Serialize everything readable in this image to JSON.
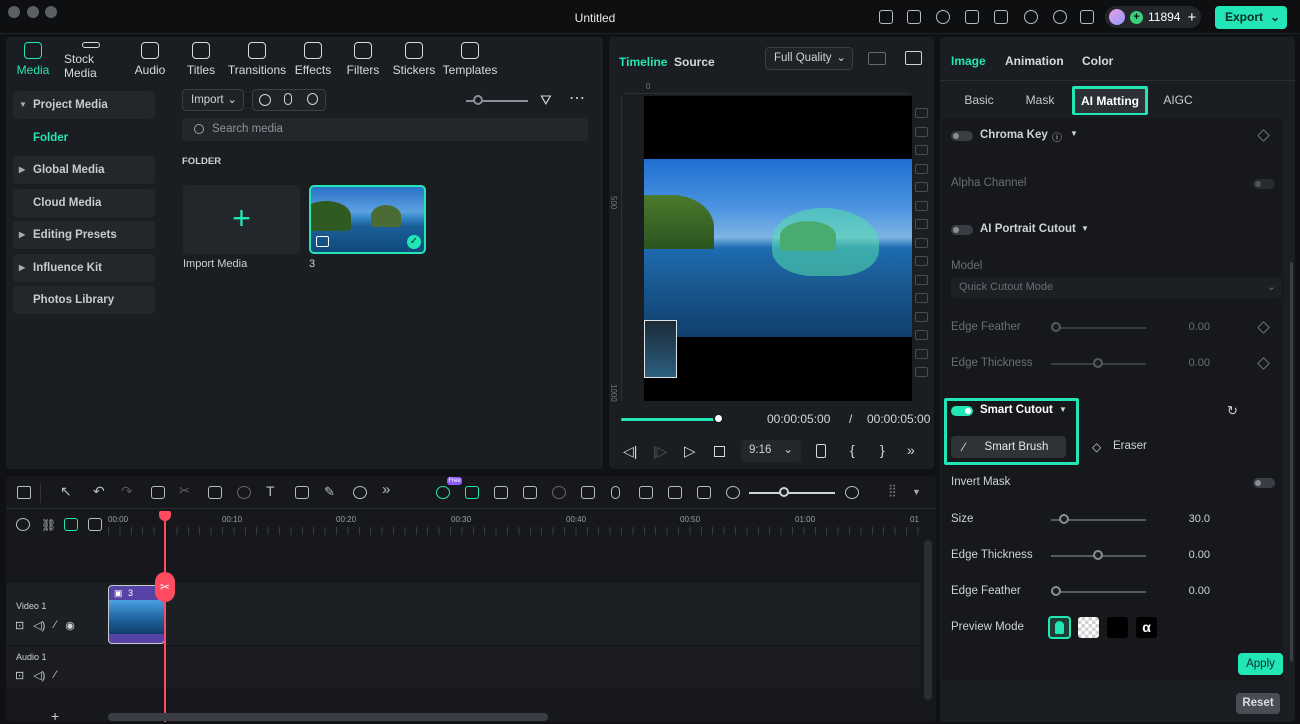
{
  "window": {
    "title": "Untitled",
    "credits": "11894",
    "export_label": "Export"
  },
  "topnav": [
    {
      "label": "Media",
      "icon": "media-icon",
      "active": true
    },
    {
      "label": "Stock Media",
      "icon": "stock-media-icon"
    },
    {
      "label": "Audio",
      "icon": "audio-icon"
    },
    {
      "label": "Titles",
      "icon": "titles-icon"
    },
    {
      "label": "Transitions",
      "icon": "transitions-icon"
    },
    {
      "label": "Effects",
      "icon": "effects-icon"
    },
    {
      "label": "Filters",
      "icon": "filters-icon"
    },
    {
      "label": "Stickers",
      "icon": "stickers-icon"
    },
    {
      "label": "Templates",
      "icon": "templates-icon"
    }
  ],
  "sidebar": {
    "items": [
      {
        "label": "Project Media"
      },
      {
        "label": "Folder"
      },
      {
        "label": "Global Media"
      },
      {
        "label": "Cloud Media"
      },
      {
        "label": "Editing Presets"
      },
      {
        "label": "Influence Kit"
      },
      {
        "label": "Photos Library"
      }
    ]
  },
  "media": {
    "import_label": "Import",
    "search_placeholder": "Search media",
    "folder_heading": "FOLDER",
    "import_tile_label": "Import Media",
    "clip_name": "3"
  },
  "preview": {
    "tab_timeline": "Timeline",
    "tab_source": "Source",
    "quality": "Full Quality",
    "current_time": "00:00:05:00",
    "separator": "/",
    "total_time": "00:00:05:00",
    "aspect": "9:16",
    "ruler_top": [
      "0"
    ],
    "ruler_left": [
      "500",
      "1000"
    ],
    "progress": 1.0
  },
  "right_panel": {
    "tabs": [
      "Image",
      "Animation",
      "Color"
    ],
    "subtabs": [
      "Basic",
      "Mask",
      "AI Matting",
      "AIGC"
    ],
    "chroma_key": "Chroma Key",
    "alpha_channel": "Alpha Channel",
    "ai_portrait": "AI Portrait Cutout",
    "model_label": "Model",
    "model_value": "Quick Cutout Mode",
    "edge_feather": "Edge Feather",
    "edge_feather_value": "0.00",
    "edge_thickness": "Edge Thickness",
    "edge_thickness_value": "0.00",
    "smart_cutout": "Smart Cutout",
    "smart_brush": "Smart Brush",
    "eraser": "Eraser",
    "invert_mask": "Invert Mask",
    "size": "Size",
    "size_value": "30.0",
    "edge_thickness2": "Edge Thickness",
    "edge_thickness2_value": "0.00",
    "edge_feather2": "Edge Feather",
    "edge_feather2_value": "0.00",
    "preview_mode": "Preview Mode",
    "alpha_glyph": "α",
    "apply": "Apply",
    "reset": "Reset"
  },
  "timeline": {
    "free_badge": "Free",
    "ticks": [
      "00:00",
      "00:10",
      "00:20",
      "00:30",
      "00:40",
      "00:50",
      "01:00",
      "01"
    ],
    "video_track": "Video 1",
    "audio_track": "Audio 1",
    "clip_label": "3",
    "add_track": "+"
  },
  "colors": {
    "accent": "#23e6b7",
    "playhead": "#ff4b5f",
    "background": "#0f1114",
    "panel": "#1a1d21"
  }
}
